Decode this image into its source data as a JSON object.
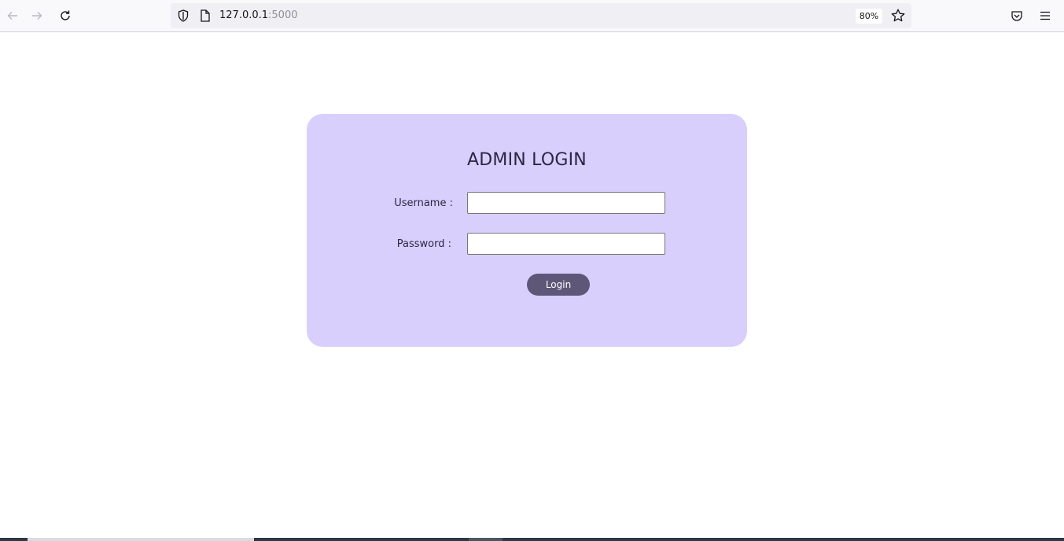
{
  "browser": {
    "url_host": "127.0.0.1",
    "url_port": ":5000",
    "zoom": "80%",
    "icons": {
      "back": "back-arrow-icon",
      "forward": "forward-arrow-icon",
      "reload": "reload-icon",
      "shield": "tracking-protection-shield-icon",
      "page": "page-icon",
      "star": "bookmark-star-icon",
      "pocket": "pocket-icon",
      "menu": "hamburger-menu-icon"
    }
  },
  "login": {
    "title": "ADMIN LOGIN",
    "username_label": "Username :",
    "username_value": "",
    "password_label": "Password :",
    "password_value": "",
    "button_label": "Login"
  },
  "colors": {
    "card_background": "#d8cffd",
    "button_background": "#5f5778",
    "title_text": "#2b2743"
  }
}
